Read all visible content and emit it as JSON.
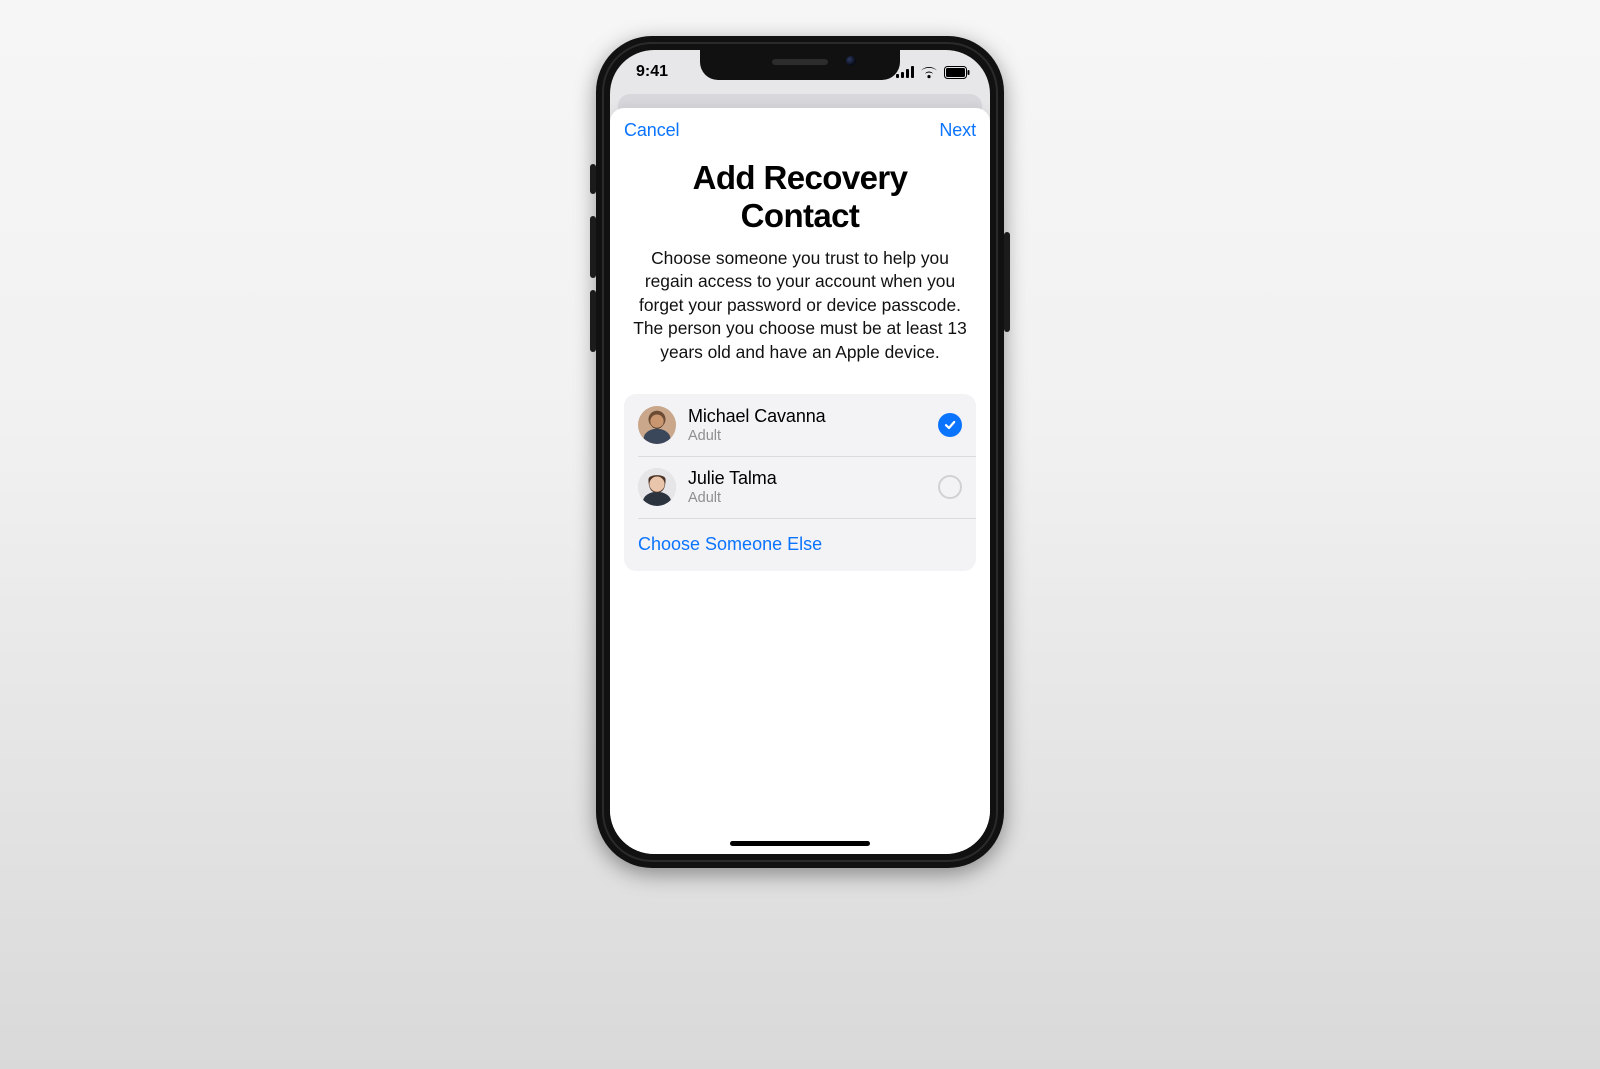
{
  "status": {
    "time": "9:41",
    "signal_icon": "cellular-icon",
    "wifi_icon": "wifi-icon",
    "battery_icon": "battery-icon"
  },
  "nav": {
    "cancel": "Cancel",
    "next": "Next"
  },
  "page": {
    "title": "Add Recovery Contact",
    "description": "Choose someone you trust to help you regain access to your account when you forget your password or device passcode. The person you choose must be at least 13 years old and have an Apple device."
  },
  "contacts": [
    {
      "name": "Michael Cavanna",
      "subtitle": "Adult",
      "selected": true
    },
    {
      "name": "Julie Talma",
      "subtitle": "Adult",
      "selected": false
    }
  ],
  "choose_else": "Choose Someone Else",
  "colors": {
    "link": "#0b74ff"
  }
}
